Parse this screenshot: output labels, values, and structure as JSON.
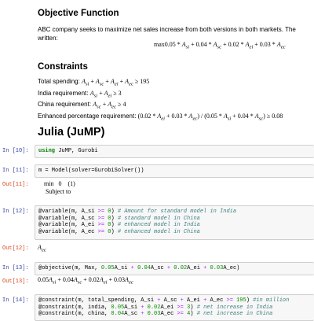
{
  "objective": {
    "heading": "Objective Function",
    "text_line1": "ABC company seeks to maximize net sales increase from both versions in both markets. The",
    "text_line2": "written:"
  },
  "constraints": {
    "heading": "Constraints",
    "total_label": "Total spending:",
    "india_label": "India requirement:",
    "china_label": "China requirement:",
    "enhanced_label": "Enhanced percentage requirement:"
  },
  "section_title": "Julia (JuMP)",
  "cells": {
    "c10": {
      "prompt": "In [10]:"
    },
    "c11": {
      "prompt": "In [11]:",
      "out_prompt": "Out[11]:",
      "out_min": "min",
      "out_zero": "0",
      "out_one": "(1)",
      "out_subject": "Subject to"
    },
    "c12": {
      "prompt": "In [12]:",
      "out_prompt": "Out[12]:"
    },
    "c13": {
      "prompt": "In [13]:",
      "out_prompt": "Out[13]:"
    },
    "c14": {
      "prompt": "In [14]:"
    }
  }
}
